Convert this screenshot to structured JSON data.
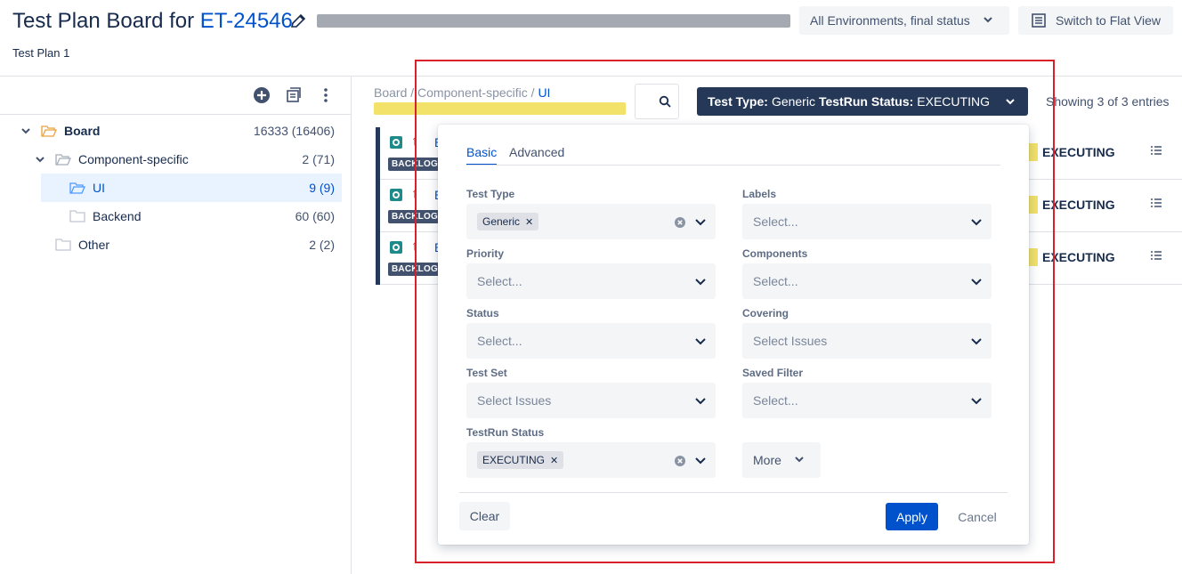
{
  "header": {
    "title_prefix": "Test Plan Board for ",
    "issue_key": "ET-24546",
    "subtitle": "Test Plan 1",
    "env_filter": "All Environments, final status",
    "flat_view": "Switch to Flat View"
  },
  "tree": {
    "items": [
      {
        "label": "Board",
        "count": "16333 (16406)"
      },
      {
        "label": "Component-specific",
        "count": "2 (71)"
      },
      {
        "label": "UI",
        "count": "9 (9)"
      },
      {
        "label": "Backend",
        "count": "60 (60)"
      },
      {
        "label": "Other",
        "count": "2 (2)"
      }
    ]
  },
  "content": {
    "breadcrumb": {
      "part1": "Board / ",
      "part2": "Component-specific / ",
      "current": "UI"
    },
    "filter": {
      "label1": "Test Type:",
      "value1": "Generic",
      "label2": "TestRun Status:",
      "value2": "EXECUTING"
    },
    "showing": "Showing 3 of 3 entries",
    "rows": [
      {
        "key": "E",
        "backlog": "BACKLOG",
        "status": "EXECUTING"
      },
      {
        "key": "E",
        "backlog": "BACKLOG",
        "status": "EXECUTING"
      },
      {
        "key": "E",
        "backlog": "BACKLOG",
        "status": "EXECUTING"
      }
    ]
  },
  "dropdown": {
    "tabs": {
      "basic": "Basic",
      "advanced": "Advanced"
    },
    "fields": {
      "test_type": {
        "label": "Test Type",
        "chip": "Generic"
      },
      "labels": {
        "label": "Labels",
        "placeholder": "Select..."
      },
      "priority": {
        "label": "Priority",
        "placeholder": "Select..."
      },
      "components": {
        "label": "Components",
        "placeholder": "Select..."
      },
      "status": {
        "label": "Status",
        "placeholder": "Select..."
      },
      "covering": {
        "label": "Covering",
        "placeholder": "Select Issues"
      },
      "test_set": {
        "label": "Test Set",
        "placeholder": "Select Issues"
      },
      "saved_filter": {
        "label": "Saved Filter",
        "placeholder": "Select..."
      },
      "testrun_status": {
        "label": "TestRun Status",
        "chip": "EXECUTING"
      }
    },
    "more": "More",
    "clear": "Clear",
    "apply": "Apply",
    "cancel": "Cancel"
  }
}
